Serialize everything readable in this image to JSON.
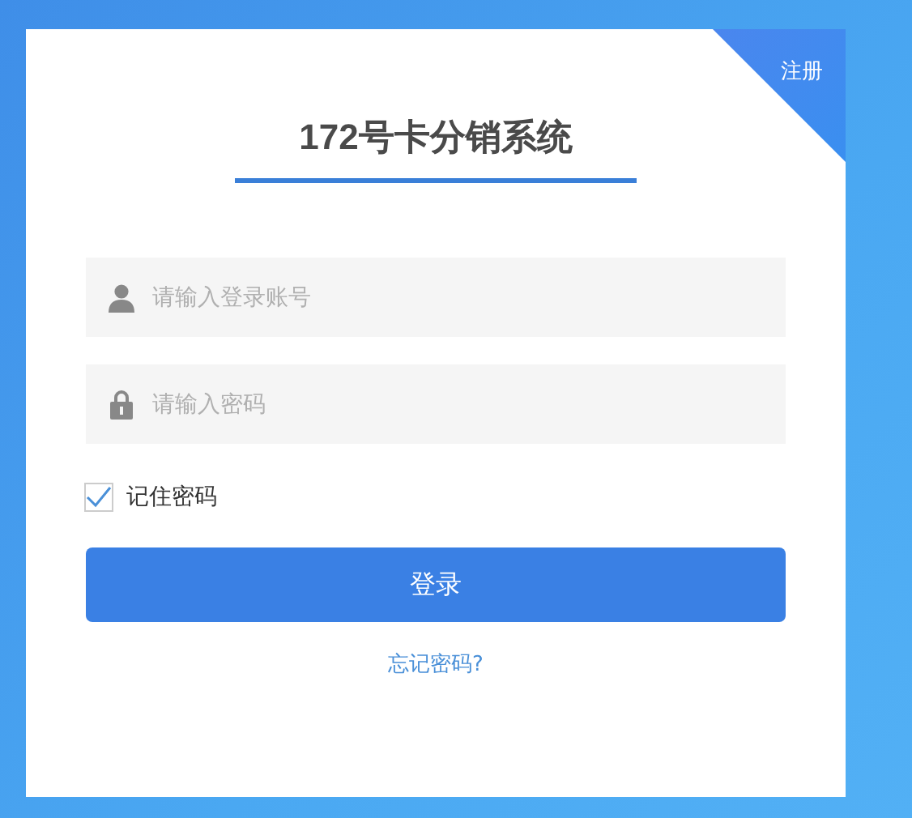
{
  "register_link": "注册",
  "title": "172号卡分销系统",
  "fields": [
    {
      "kind": "user",
      "placeholder": "请输入登录账号"
    },
    {
      "kind": "password",
      "placeholder": "请输入密码"
    }
  ],
  "remember": {
    "label": "记住密码",
    "checked": true
  },
  "login_button": "登录",
  "forgot_link": "忘记密码?"
}
